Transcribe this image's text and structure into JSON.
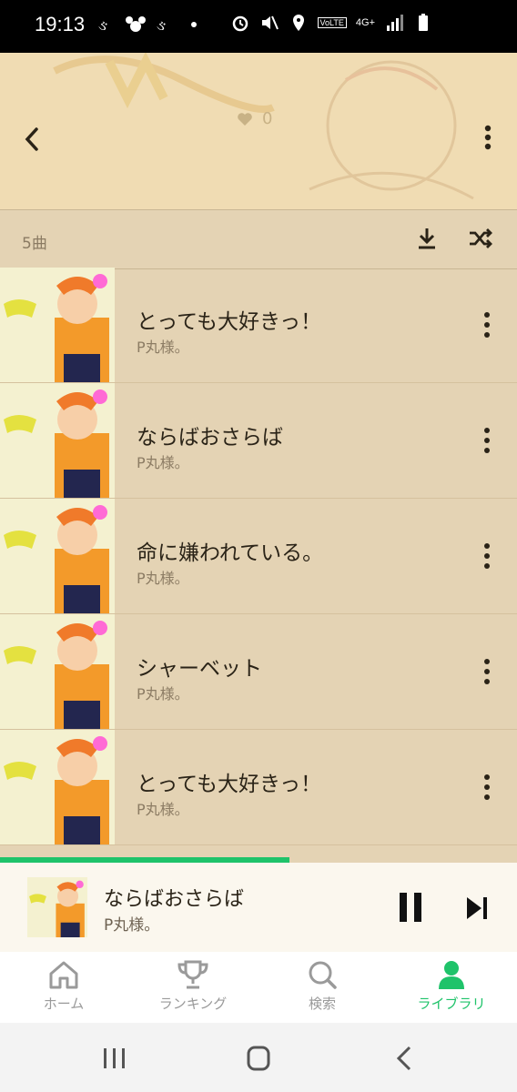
{
  "status": {
    "time": "19:13",
    "network": "4G+",
    "volte": "VoLTE"
  },
  "header": {
    "likes": "0"
  },
  "list": {
    "count": "5曲",
    "tracks": [
      {
        "title": "とっても大好きっ！",
        "artist": "P丸様。"
      },
      {
        "title": "ならばおさらば",
        "artist": "P丸様。"
      },
      {
        "title": "命に嫌われている。",
        "artist": "P丸様。"
      },
      {
        "title": "シャーベット",
        "artist": "P丸様。"
      },
      {
        "title": "とっても大好きっ！",
        "artist": "P丸様。"
      }
    ]
  },
  "player": {
    "title": "ならばおさらば",
    "artist": "P丸様。",
    "progress_fraction": 0.56
  },
  "nav": {
    "items": [
      {
        "label": "ホーム"
      },
      {
        "label": "ランキング"
      },
      {
        "label": "検索"
      },
      {
        "label": "ライブラリ"
      }
    ],
    "active_index": 3
  },
  "colors": {
    "accent": "#1fc36a",
    "list_bg": "#e4d3b4",
    "header_bg": "#f0dcb3"
  }
}
